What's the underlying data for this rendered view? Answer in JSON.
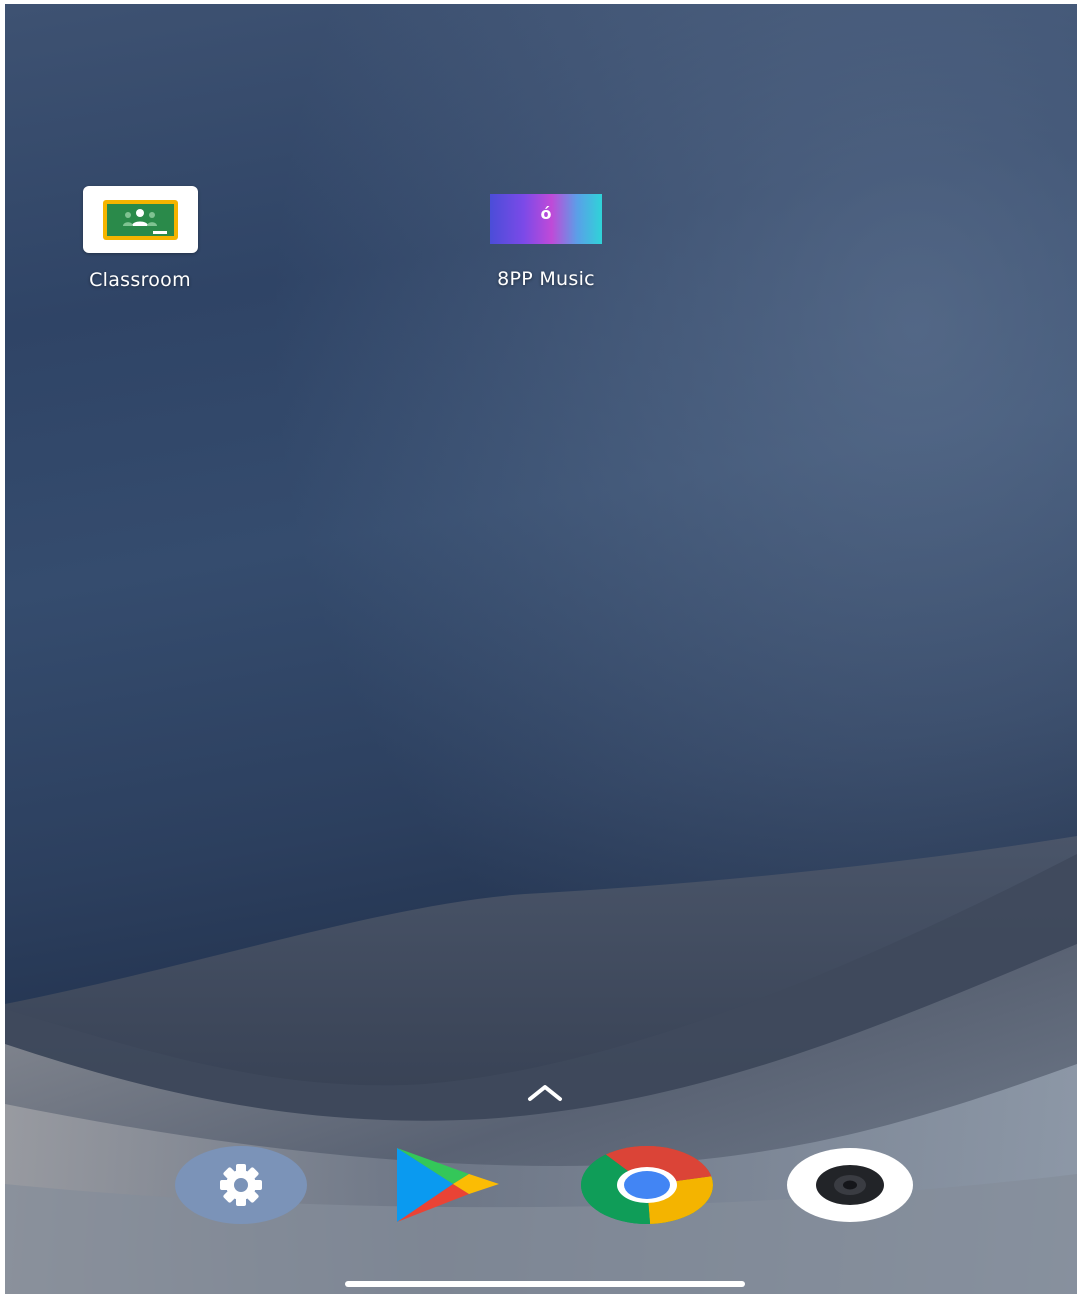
{
  "home_screen": {
    "apps": [
      {
        "label": "Classroom",
        "icon": "google-classroom-icon"
      },
      {
        "label": "8PP Music",
        "icon": "music-note-icon",
        "icon_glyph": "ó"
      }
    ]
  },
  "dock": {
    "items": [
      {
        "icon": "settings-gear-icon",
        "accent": "#7b93b8"
      },
      {
        "icon": "play-store-icon"
      },
      {
        "icon": "chrome-icon"
      },
      {
        "icon": "camera-lens-icon"
      }
    ]
  },
  "app_drawer_handle": {
    "icon": "chevron-up-icon"
  },
  "colors": {
    "wallpaper_sky": "#34496b",
    "classroom_green": "#2a8a4a",
    "classroom_yellow": "#f5b400",
    "chrome_red": "#db4437",
    "chrome_green": "#0f9d58",
    "chrome_yellow": "#f4b400",
    "chrome_blue": "#4285f4"
  }
}
